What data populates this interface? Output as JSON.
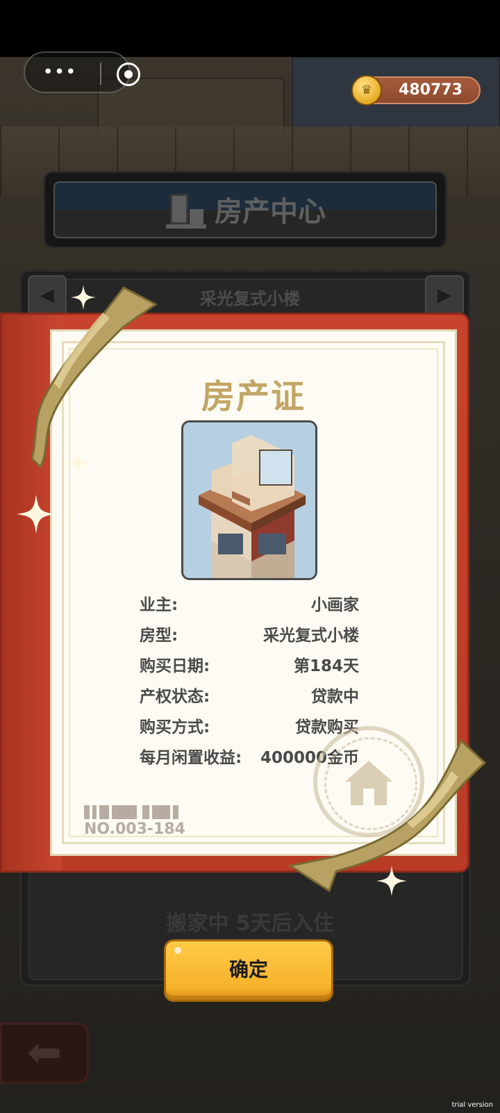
{
  "hud": {
    "coins": "480773"
  },
  "header": {
    "title": "房产中心"
  },
  "selector": {
    "house_name": "采光复式小楼",
    "prev_arrow": "◀",
    "next_arrow": "▶"
  },
  "certificate": {
    "title": "房产证",
    "rows": [
      {
        "label": "业主:",
        "value": "小画家"
      },
      {
        "label": "房型:",
        "value": "采光复式小楼"
      },
      {
        "label": "购买日期:",
        "value": "第184天"
      },
      {
        "label": "产权状态:",
        "value": "贷款中"
      },
      {
        "label": "购买方式:",
        "value": "贷款购买"
      },
      {
        "label": "每月闲置收益:",
        "value": "400000金币"
      }
    ],
    "serial": "NO.003-184"
  },
  "status": {
    "moving": "搬家中 5天后入住"
  },
  "buttons": {
    "confirm": "确定",
    "back_arrow": "⬅"
  },
  "watermark": "trial version",
  "icons": {
    "menu": "more-dots-icon",
    "close": "target-circle-icon",
    "coin": "crown-coin-icon",
    "building": "building-icon",
    "stamp": "house-stamp-icon"
  },
  "colors": {
    "cover_red": "#c8432b",
    "gold_text": "#c3a565",
    "button_yellow": "#f6b12a"
  }
}
